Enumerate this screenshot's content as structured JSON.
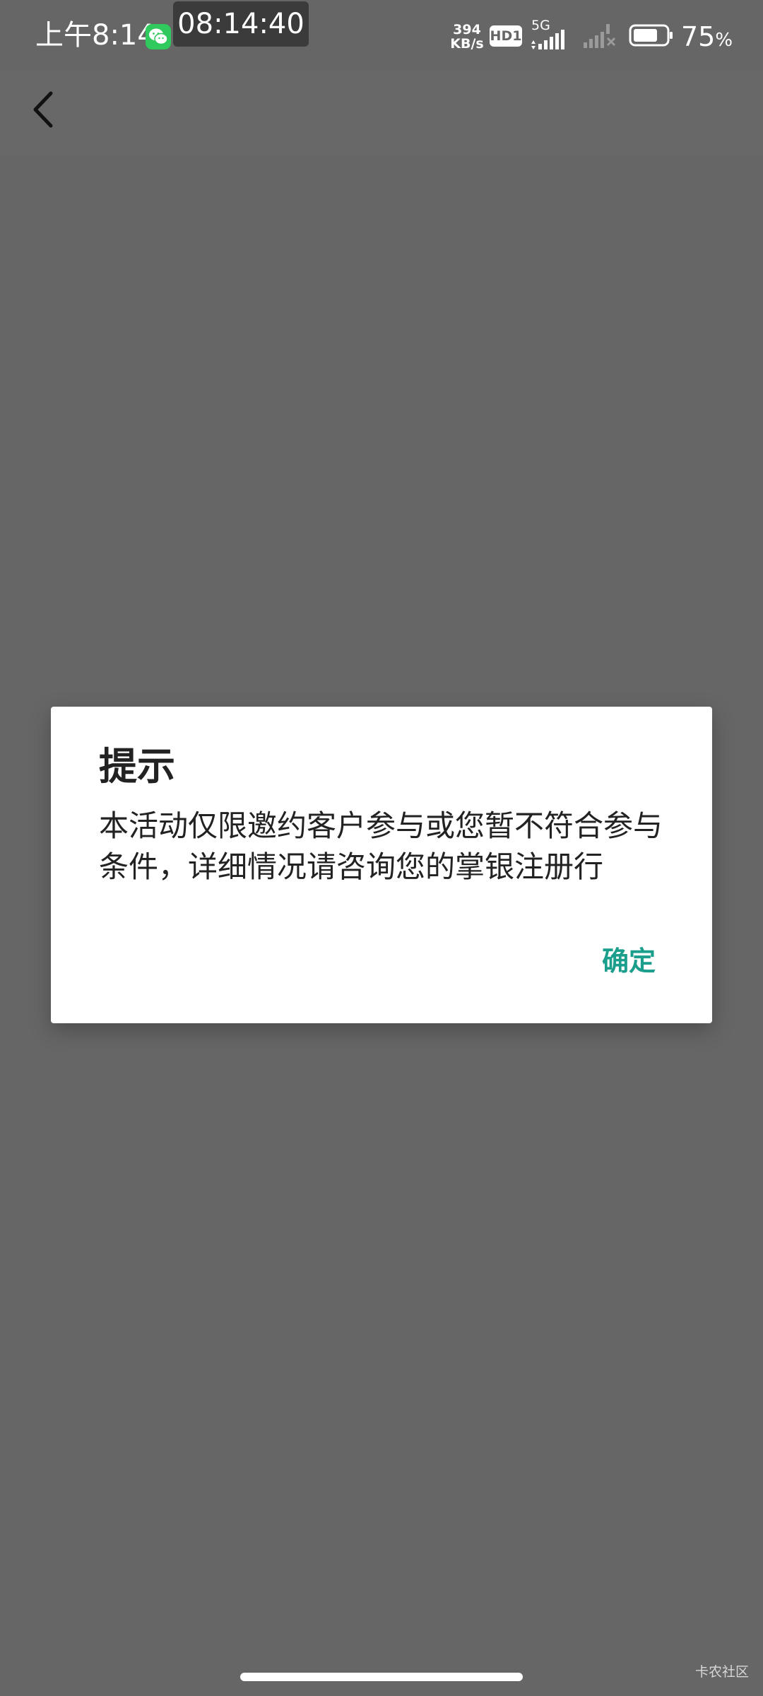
{
  "status_bar": {
    "time": "上午8:14",
    "clock_chip": "08:14:40",
    "net_speed_value": "394",
    "net_speed_unit": "KB/s",
    "hd_badge": "HD1",
    "network_type": "5G",
    "battery_percent": "75",
    "battery_symbol": "%",
    "battery_level": 0.75,
    "icons": [
      "wechat-icon",
      "signal-icon",
      "signal-no-service-icon",
      "battery-icon"
    ]
  },
  "app_bar": {
    "back_icon": "chevron-left-icon"
  },
  "dialog": {
    "title": "提示",
    "message": "本活动仅限邀约客户参与或您暂不符合参与条件，详细情况请咨询您的掌银注册行",
    "confirm_label": "确定"
  },
  "colors": {
    "overlay_background": "#666666",
    "dialog_background": "#ffffff",
    "accent": "#1b9e8c",
    "wechat_green": "#2fc95d"
  },
  "watermark": "卡农社区"
}
